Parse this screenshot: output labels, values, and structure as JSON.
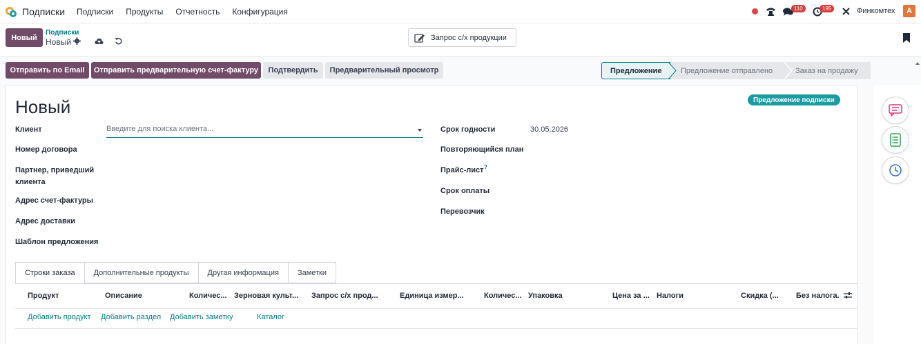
{
  "navbar": {
    "app_name": "Подписки",
    "menu": [
      "Подписки",
      "Продукты",
      "Отчетность",
      "Конфигурация"
    ],
    "badge_messages": "110",
    "badge_activities": "195",
    "company": "Финкомтех",
    "avatar_letter": "A"
  },
  "control": {
    "new_label": "Новый",
    "breadcrumb_parent": "Подписки",
    "breadcrumb_current": "Новый",
    "request_button": "Запрос с/х продукции"
  },
  "actions": {
    "send_email": "Отправить по Email",
    "send_proforma": "Отправить предварительную счет-фактуру",
    "confirm": "Подтвердить",
    "preview": "Предварительный просмотр"
  },
  "status": [
    "Предложение",
    "Предложение отправлено",
    "Заказ на продажу"
  ],
  "form": {
    "title": "Новый",
    "badge": "Предложение подписки",
    "client_label": "Клиент",
    "client_placeholder": "Введите для поиска клиента...",
    "contract_label": "Номер договора",
    "referrer_label_1": "Партнер, приведший",
    "referrer_label_2": "клиента",
    "invoice_address_label": "Адрес счет-фактуры",
    "delivery_address_label": "Адрес доставки",
    "template_label": "Шаблон предложения",
    "expiry_label": "Срок годности",
    "expiry_value": "30.05.2026",
    "recurring_label": "Повторяющийся план",
    "pricelist_label": "Прайс-лист",
    "pricelist_help": "?",
    "payment_terms_label": "Срок оплаты",
    "carrier_label": "Перевозчик"
  },
  "tabs": [
    "Строки заказа",
    "Дополнительные продукты",
    "Другая информация",
    "Заметки"
  ],
  "columns": [
    "Продукт",
    "Описание",
    "Количес...",
    "Зерновая культ...",
    "Запрос с/х прод...",
    "Единица измер...",
    "Количес...",
    "Упаковка",
    "Цена за ...",
    "Налоги",
    "Скидка (...",
    "Без налога."
  ],
  "links": {
    "add_product": "Добавить продукт",
    "add_section": "Добавить раздел",
    "add_note": "Добавить заметку",
    "catalog": "Каталог"
  },
  "colors": {
    "primary": "#714B67",
    "teal": "#017e84",
    "badge": "#1b9ba4"
  }
}
